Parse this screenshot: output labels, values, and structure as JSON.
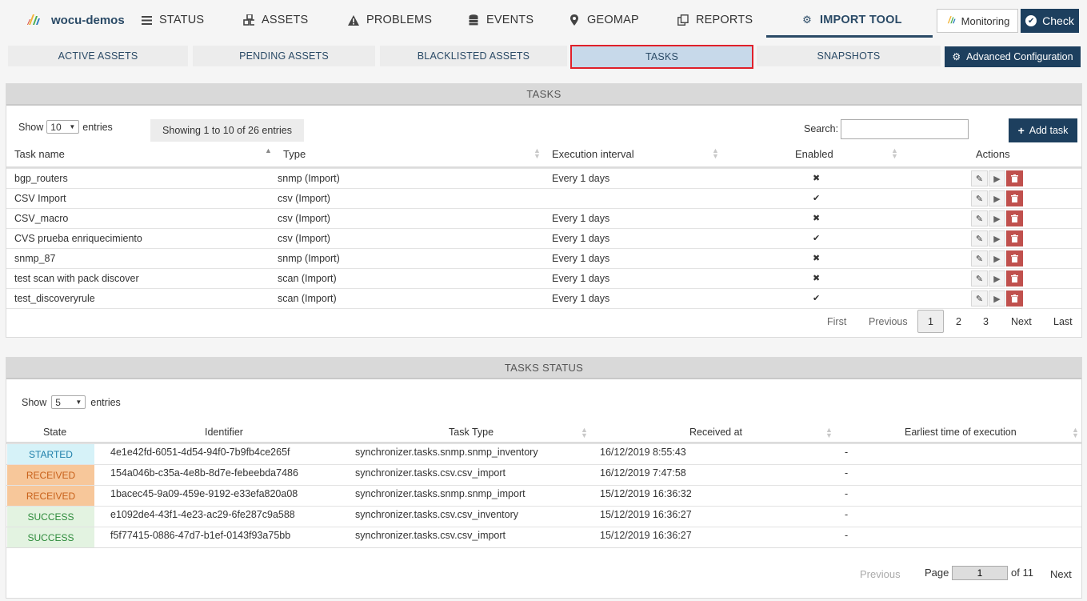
{
  "brand": {
    "name": "wocu-demos"
  },
  "nav": {
    "items": [
      {
        "label": "STATUS",
        "icon": "list-icon"
      },
      {
        "label": "ASSETS",
        "icon": "cubes-icon"
      },
      {
        "label": "PROBLEMS",
        "icon": "warning-icon"
      },
      {
        "label": "EVENTS",
        "icon": "database-icon"
      },
      {
        "label": "GEOMAP",
        "icon": "map-marker-icon"
      },
      {
        "label": "REPORTS",
        "icon": "copy-icon"
      },
      {
        "label": "IMPORT TOOL",
        "icon": "gear-icon"
      }
    ],
    "monitoring_label": "Monitoring",
    "check_label": "Check"
  },
  "subtabs": {
    "items": [
      "ACTIVE ASSETS",
      "PENDING ASSETS",
      "BLACKLISTED ASSETS",
      "TASKS",
      "SNAPSHOTS"
    ],
    "active": "TASKS",
    "advanced_label": "Advanced Configuration"
  },
  "tasks": {
    "title": "TASKS",
    "show_label": "Show",
    "entries_value": "10",
    "entries_label": "entries",
    "info": "Showing 1 to 10 of 26 entries",
    "search_label": "Search:",
    "search_value": "",
    "add_label": "Add task",
    "columns": [
      "Task name",
      "Type",
      "Execution interval",
      "Enabled",
      "Actions"
    ],
    "rows": [
      {
        "name": "bgp_routers",
        "type": "snmp (Import)",
        "interval": "Every 1 days",
        "enabled": "✖"
      },
      {
        "name": "CSV Import",
        "type": "csv (Import)",
        "interval": "",
        "enabled": "✔"
      },
      {
        "name": "CSV_macro",
        "type": "csv (Import)",
        "interval": "Every 1 days",
        "enabled": "✖"
      },
      {
        "name": "CVS prueba enriquecimiento",
        "type": "csv (Import)",
        "interval": "Every 1 days",
        "enabled": "✔"
      },
      {
        "name": "snmp_87",
        "type": "snmp (Import)",
        "interval": "Every 1 days",
        "enabled": "✖"
      },
      {
        "name": "test scan with pack discover",
        "type": "scan (Import)",
        "interval": "Every 1 days",
        "enabled": "✖"
      },
      {
        "name": "test_discoveryrule",
        "type": "scan (Import)",
        "interval": "Every 1 days",
        "enabled": "✔"
      }
    ],
    "pagination": {
      "first": "First",
      "previous": "Previous",
      "pages": [
        "1",
        "2",
        "3"
      ],
      "current": "1",
      "next": "Next",
      "last": "Last"
    }
  },
  "status": {
    "title": "TASKS STATUS",
    "show_label": "Show",
    "entries_value": "5",
    "entries_label": "entries",
    "columns": [
      "State",
      "Identifier",
      "Task Type",
      "Received at",
      "Earliest time of execution"
    ],
    "rows": [
      {
        "state": "STARTED",
        "id": "4e1e42fd-6051-4d54-94f0-7b9fb4ce265f",
        "task_type": "synchronizer.tasks.snmp.snmp_inventory",
        "received": "16/12/2019 8:55:43",
        "earliest": "-"
      },
      {
        "state": "RECEIVED",
        "id": "154a046b-c35a-4e8b-8d7e-febeebda7486",
        "task_type": "synchronizer.tasks.csv.csv_import",
        "received": "16/12/2019 7:47:58",
        "earliest": "-"
      },
      {
        "state": "RECEIVED",
        "id": "1bacec45-9a09-459e-9192-e33efa820a08",
        "task_type": "synchronizer.tasks.snmp.snmp_import",
        "received": "15/12/2019 16:36:32",
        "earliest": "-"
      },
      {
        "state": "SUCCESS",
        "id": "e1092de4-43f1-4e23-ac29-6fe287c9a588",
        "task_type": "synchronizer.tasks.csv.csv_inventory",
        "received": "15/12/2019 16:36:27",
        "earliest": "-"
      },
      {
        "state": "SUCCESS",
        "id": "f5f77415-0886-47d7-b1ef-0143f93a75bb",
        "task_type": "synchronizer.tasks.csv.csv_import",
        "received": "15/12/2019 16:36:27",
        "earliest": "-"
      }
    ],
    "pagination": {
      "previous": "Previous",
      "page_label": "Page",
      "page_value": "1",
      "of_label": "of 11",
      "next": "Next"
    }
  },
  "colors": {
    "primary": "#1d3f5e",
    "highlight": "#e0202a",
    "delete": "#c0504d"
  }
}
